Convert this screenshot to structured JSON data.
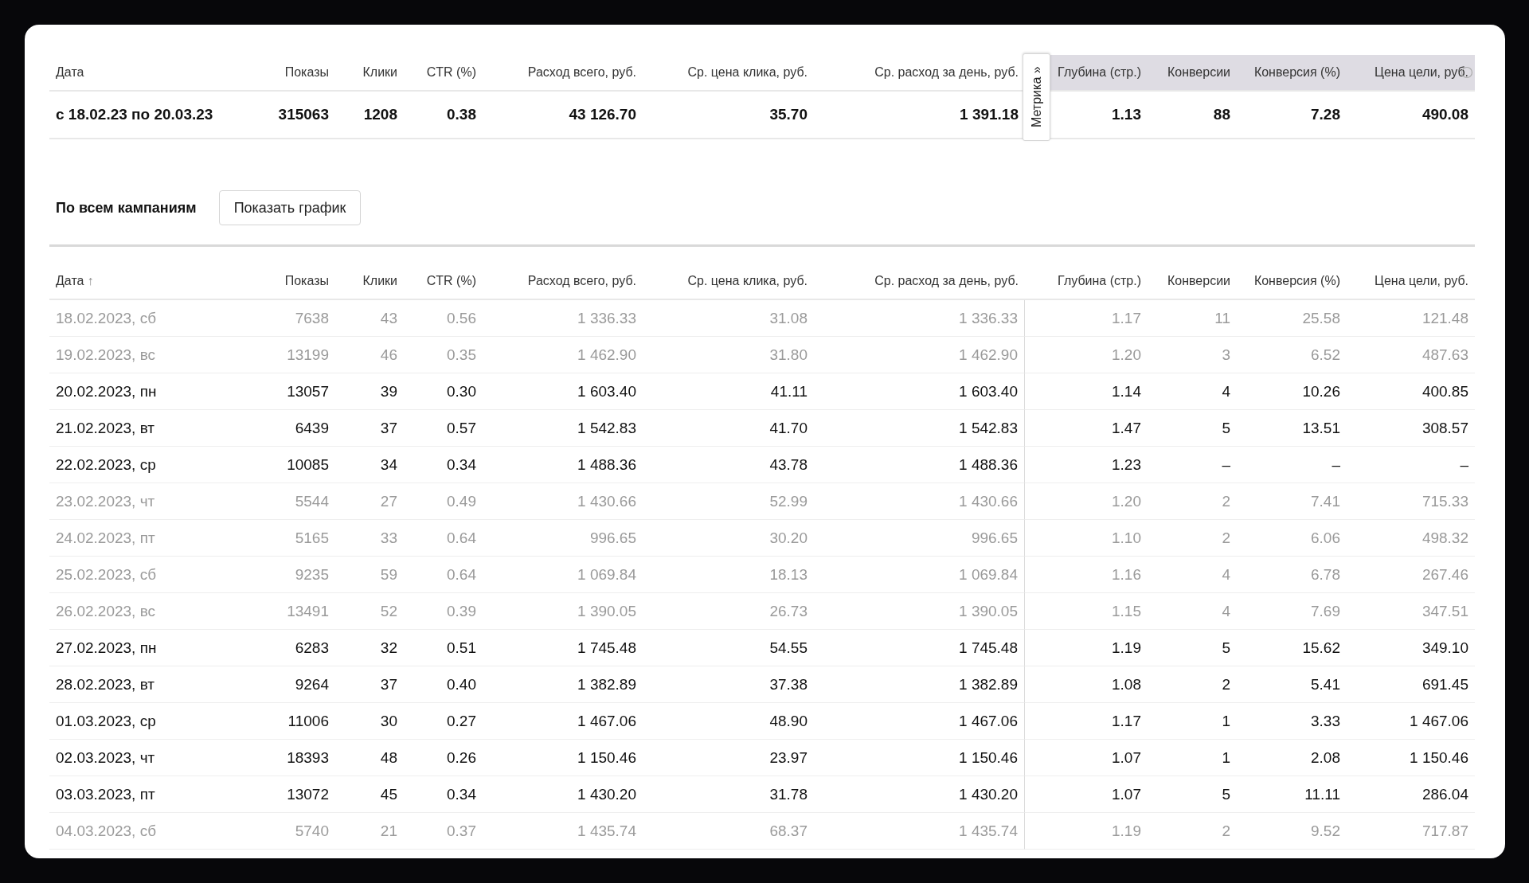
{
  "summary": {
    "columns": [
      {
        "label": "Дата",
        "kind": "direct"
      },
      {
        "label": "Показы",
        "kind": "direct"
      },
      {
        "label": "Клики",
        "kind": "direct"
      },
      {
        "label": "CTR (%)",
        "kind": "direct"
      },
      {
        "label": "Расход всего, руб.",
        "kind": "direct"
      },
      {
        "label": "Ср. цена клика, руб.",
        "kind": "direct"
      },
      {
        "label": "Ср. расход за день, руб.",
        "kind": "direct"
      },
      {
        "label": "Глубина (стр.)",
        "kind": "metrika"
      },
      {
        "label": "Конверсии",
        "kind": "metrika"
      },
      {
        "label": "Конверсия (%)",
        "kind": "metrika"
      },
      {
        "label": "Цена цели, руб.",
        "kind": "metrika"
      }
    ],
    "values": [
      "с 18.02.23 по 20.03.23",
      "315063",
      "1208",
      "0.38",
      "43 126.70",
      "35.70",
      "1 391.18",
      "1.13",
      "88",
      "7.28",
      "490.08"
    ]
  },
  "metrika_tab": "Метрика »",
  "section": {
    "title": "По всем кампаниям",
    "button": "Показать график"
  },
  "table": {
    "sort_mark": "↑",
    "columns": [
      {
        "label": "Дата",
        "kind": "direct"
      },
      {
        "label": "Показы",
        "kind": "direct"
      },
      {
        "label": "Клики",
        "kind": "direct"
      },
      {
        "label": "CTR (%)",
        "kind": "direct"
      },
      {
        "label": "Расход всего, руб.",
        "kind": "direct"
      },
      {
        "label": "Ср. цена клика, руб.",
        "kind": "direct"
      },
      {
        "label": "Ср. расход за день, руб.",
        "kind": "direct"
      },
      {
        "label": "Глубина (стр.)",
        "kind": "metrika"
      },
      {
        "label": "Конверсии",
        "kind": "metrika"
      },
      {
        "label": "Конверсия (%)",
        "kind": "metrika"
      },
      {
        "label": "Цена цели, руб.",
        "kind": "metrika"
      }
    ],
    "rows": [
      {
        "dimmed": true,
        "cells": [
          "18.02.2023, сб",
          "7638",
          "43",
          "0.56",
          "1 336.33",
          "31.08",
          "1 336.33",
          "1.17",
          "11",
          "25.58",
          "121.48"
        ]
      },
      {
        "dimmed": true,
        "cells": [
          "19.02.2023, вс",
          "13199",
          "46",
          "0.35",
          "1 462.90",
          "31.80",
          "1 462.90",
          "1.20",
          "3",
          "6.52",
          "487.63"
        ]
      },
      {
        "dimmed": false,
        "cells": [
          "20.02.2023, пн",
          "13057",
          "39",
          "0.30",
          "1 603.40",
          "41.11",
          "1 603.40",
          "1.14",
          "4",
          "10.26",
          "400.85"
        ]
      },
      {
        "dimmed": false,
        "cells": [
          "21.02.2023, вт",
          "6439",
          "37",
          "0.57",
          "1 542.83",
          "41.70",
          "1 542.83",
          "1.47",
          "5",
          "13.51",
          "308.57"
        ]
      },
      {
        "dimmed": false,
        "cells": [
          "22.02.2023, ср",
          "10085",
          "34",
          "0.34",
          "1 488.36",
          "43.78",
          "1 488.36",
          "1.23",
          "–",
          "–",
          "–"
        ]
      },
      {
        "dimmed": true,
        "cells": [
          "23.02.2023, чт",
          "5544",
          "27",
          "0.49",
          "1 430.66",
          "52.99",
          "1 430.66",
          "1.20",
          "2",
          "7.41",
          "715.33"
        ]
      },
      {
        "dimmed": true,
        "cells": [
          "24.02.2023, пт",
          "5165",
          "33",
          "0.64",
          "996.65",
          "30.20",
          "996.65",
          "1.10",
          "2",
          "6.06",
          "498.32"
        ]
      },
      {
        "dimmed": true,
        "cells": [
          "25.02.2023, сб",
          "9235",
          "59",
          "0.64",
          "1 069.84",
          "18.13",
          "1 069.84",
          "1.16",
          "4",
          "6.78",
          "267.46"
        ]
      },
      {
        "dimmed": true,
        "cells": [
          "26.02.2023, вс",
          "13491",
          "52",
          "0.39",
          "1 390.05",
          "26.73",
          "1 390.05",
          "1.15",
          "4",
          "7.69",
          "347.51"
        ]
      },
      {
        "dimmed": false,
        "cells": [
          "27.02.2023, пн",
          "6283",
          "32",
          "0.51",
          "1 745.48",
          "54.55",
          "1 745.48",
          "1.19",
          "5",
          "15.62",
          "349.10"
        ]
      },
      {
        "dimmed": false,
        "cells": [
          "28.02.2023, вт",
          "9264",
          "37",
          "0.40",
          "1 382.89",
          "37.38",
          "1 382.89",
          "1.08",
          "2",
          "5.41",
          "691.45"
        ]
      },
      {
        "dimmed": false,
        "cells": [
          "01.03.2023, ср",
          "11006",
          "30",
          "0.27",
          "1 467.06",
          "48.90",
          "1 467.06",
          "1.17",
          "1",
          "3.33",
          "1 467.06"
        ]
      },
      {
        "dimmed": false,
        "cells": [
          "02.03.2023, чт",
          "18393",
          "48",
          "0.26",
          "1 150.46",
          "23.97",
          "1 150.46",
          "1.07",
          "1",
          "2.08",
          "1 150.46"
        ]
      },
      {
        "dimmed": false,
        "cells": [
          "03.03.2023, пт",
          "13072",
          "45",
          "0.34",
          "1 430.20",
          "31.78",
          "1 430.20",
          "1.07",
          "5",
          "11.11",
          "286.04"
        ]
      },
      {
        "dimmed": true,
        "cells": [
          "04.03.2023, сб",
          "5740",
          "21",
          "0.37",
          "1 435.74",
          "68.37",
          "1 435.74",
          "1.19",
          "2",
          "9.52",
          "717.87"
        ]
      }
    ]
  }
}
